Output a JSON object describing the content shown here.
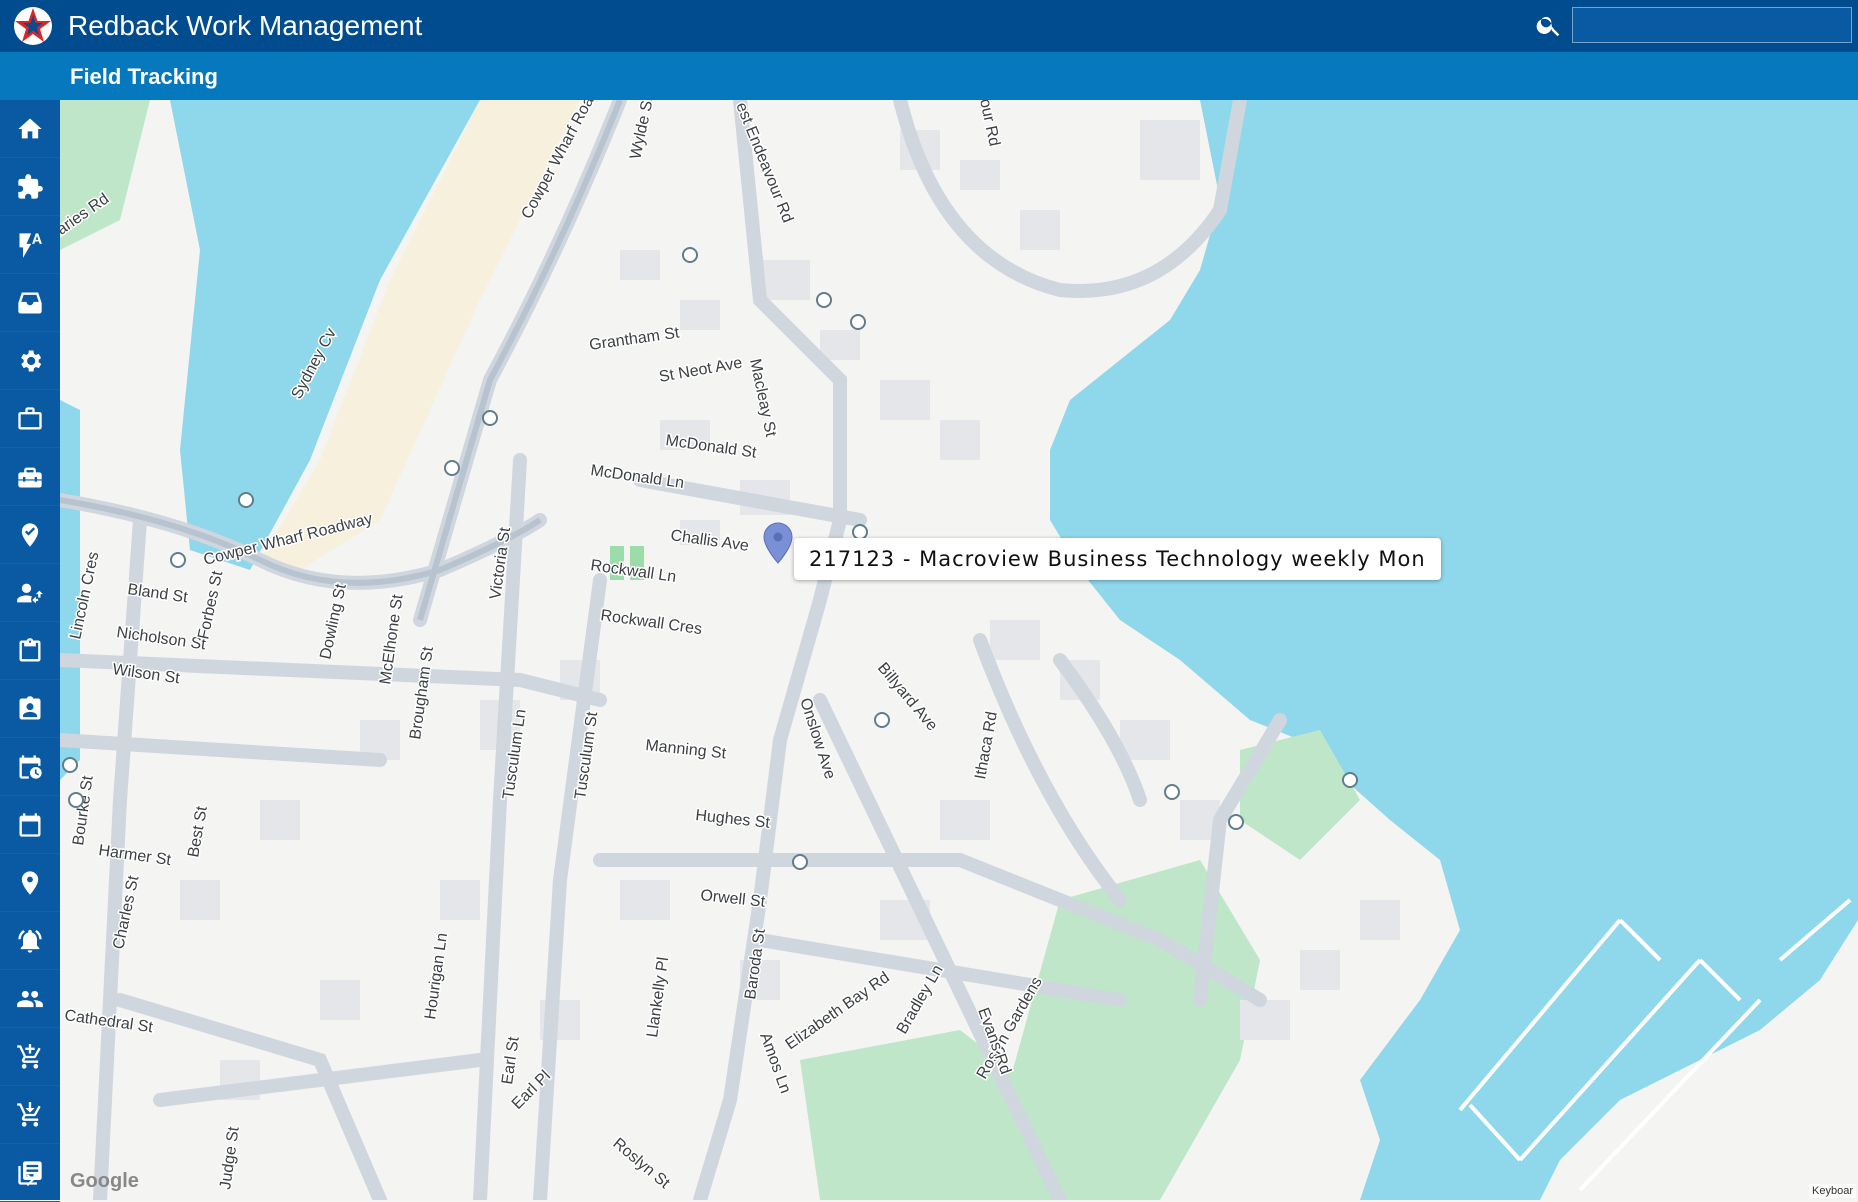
{
  "header": {
    "app_title": "Redback Work Management",
    "search_placeholder": "",
    "search_value": ""
  },
  "subheader": {
    "title": "Field Tracking"
  },
  "sidebar": {
    "items": [
      {
        "icon": "home-icon"
      },
      {
        "icon": "puzzle-icon"
      },
      {
        "icon": "flash-auto-icon"
      },
      {
        "icon": "inbox-tray-icon"
      },
      {
        "icon": "gear-icon"
      },
      {
        "icon": "briefcase-icon"
      },
      {
        "icon": "toolbox-icon"
      },
      {
        "icon": "verified-pin-icon"
      },
      {
        "icon": "person-switch-icon"
      },
      {
        "icon": "clipboard-icon"
      },
      {
        "icon": "contact-badge-icon"
      },
      {
        "icon": "calendar-clock-icon"
      },
      {
        "icon": "calendar-icon"
      },
      {
        "icon": "location-pin-icon"
      },
      {
        "icon": "alarm-bell-icon"
      },
      {
        "icon": "people-icon"
      },
      {
        "icon": "cart-add-icon"
      },
      {
        "icon": "cart-download-icon"
      },
      {
        "icon": "library-icon"
      }
    ],
    "expand_icon": "chevron-right-icon"
  },
  "map": {
    "marker_label": "217123 - Macroview Business Technology weekly Mon",
    "attribution": "Google",
    "keyboard_hint": "Keyboar",
    "colors": {
      "water": "#8fd8ec",
      "park": "#bfe6c8",
      "road": "#cfd6de",
      "land": "#f4f4f2",
      "marker": "#7b8fd6"
    },
    "streets": [
      "Cowper Wharf Roa",
      "Wylde St",
      "Grantham St",
      "St Neot Ave",
      "Macleay St",
      "McDonald St",
      "McDonald Ln",
      "Challis Ave",
      "Rockwall Ln",
      "Rockwall Cres",
      "Victoria St",
      "Sydney Cv",
      "Cowper Wharf Roadway",
      "Bland St",
      "Nicholson St",
      "Wilson St",
      "Lincoln Cres",
      "Forbes St",
      "Dowling St",
      "McElhone St",
      "Brougham St",
      "Manning St",
      "Tusculum Ln",
      "Tusculum St",
      "Hughes St",
      "Orwell St",
      "Onslow Ave",
      "Billyard Ave",
      "Ithaca Rd",
      "Elizabeth Bay Rd",
      "Bradley Ln",
      "Roslyn Gardens",
      "Evans Rd",
      "Baroda St",
      "Amos Ln",
      "Harmer St",
      "Best St",
      "Bourke St",
      "Charles St",
      "Cathedral St",
      "Hourigan Ln",
      "Llankelly Pl",
      "Earl St",
      "Earl Pl",
      "Roslyn St",
      "cquaries Rd",
      "est Endeavour Rd",
      "our Rd",
      "Judge St"
    ]
  }
}
